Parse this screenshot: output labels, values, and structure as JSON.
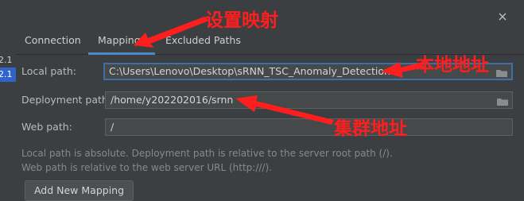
{
  "tabs": [
    {
      "label": "Connection",
      "active": false
    },
    {
      "label": "Mappings",
      "active": true
    },
    {
      "label": "Excluded Paths",
      "active": false
    }
  ],
  "left_list": [
    "2.1",
    "2.1"
  ],
  "form": {
    "local_path": {
      "label": "Local path:",
      "value": "C:\\Users\\Lenovo\\Desktop\\sRNN_TSC_Anomaly_Detection"
    },
    "deployment_path": {
      "label": "Deployment path:",
      "value": "/home/y202202016/srnn"
    },
    "web_path": {
      "label": "Web path:",
      "value": "/"
    }
  },
  "hints": [
    "Local path is absolute. Deployment path is relative to the server root path (/).",
    "Web path is relative to the web server URL (http:///)."
  ],
  "buttons": {
    "add_mapping": "Add New Mapping"
  },
  "annotations": {
    "set_mapping": "设置映射",
    "local_address": "本地地址",
    "cluster_address": "集群地址"
  },
  "colors": {
    "annotation": "#ff1e1e",
    "accent": "#4a88c7",
    "selection": "#2f65ca"
  },
  "icons": [
    "close-icon",
    "folder-icon"
  ]
}
